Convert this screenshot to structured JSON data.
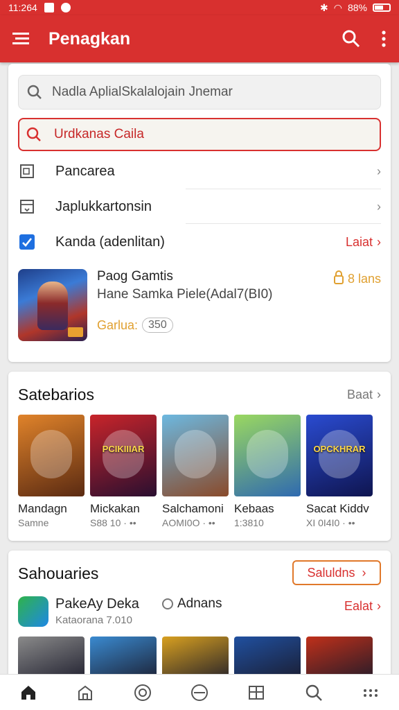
{
  "status_bar": {
    "time": "11:264",
    "battery": "88%"
  },
  "app_bar": {
    "title": "Penagkan"
  },
  "search": {
    "placeholder": "Nadla AplialSkalalojain Jnemar",
    "active_query": "Urdkanas Caila"
  },
  "menu": {
    "items": [
      {
        "label": "Pancarea",
        "right": ""
      },
      {
        "label": "Japlukkartonsin",
        "right": ""
      },
      {
        "label": "Kanda (adenlitan)",
        "right": "Laiat"
      }
    ]
  },
  "feature": {
    "name": "Paog Gamtis",
    "desc": "Hane Samka Piele(Adal7(BI0)",
    "meta": "Garlua:",
    "meta_pill": "350",
    "price": "8 lans"
  },
  "section1": {
    "title": "Satebarios",
    "more": "Baat",
    "tiles": [
      {
        "name": "Mandagn",
        "sub": "Samne",
        "tag": "",
        "color1": "#e0832a",
        "color2": "#5a2a12"
      },
      {
        "name": "Mickakan",
        "sub": "S88 10 · ••",
        "tag": "PCIKIIIAR",
        "color1": "#c8242a",
        "color2": "#2a0f30"
      },
      {
        "name": "Salchamoni",
        "sub": "AOMI0O · ••",
        "tag": "",
        "color1": "#6cb8e0",
        "color2": "#8a4a2a"
      },
      {
        "name": "Kebaas",
        "sub": "1:3810",
        "tag": "",
        "color1": "#9ad860",
        "color2": "#2f6ab0"
      },
      {
        "name": "Sacat Kiddv",
        "sub": "XI 0I4I0 · ••",
        "tag": "OPCKHRAR",
        "color1": "#2a4bd0",
        "color2": "#0f1550"
      }
    ]
  },
  "section2": {
    "title": "Sahouaries",
    "button": "Saluldns",
    "app": {
      "name": "PakeAy Deka",
      "sub": "Kataorana 7.010",
      "stat": "Adnans",
      "link": "Ealat"
    },
    "strip_colors": [
      "#8a8a8a",
      "#3a8ad0",
      "#d8a020",
      "#2050a0",
      "#c0301a"
    ]
  },
  "bottom_nav": [
    {
      "icon": "home-icon"
    },
    {
      "icon": "store-icon"
    },
    {
      "icon": "games-icon"
    },
    {
      "icon": "add-icon"
    },
    {
      "icon": "library-icon"
    },
    {
      "icon": "search-icon"
    },
    {
      "icon": "more-icon"
    }
  ]
}
